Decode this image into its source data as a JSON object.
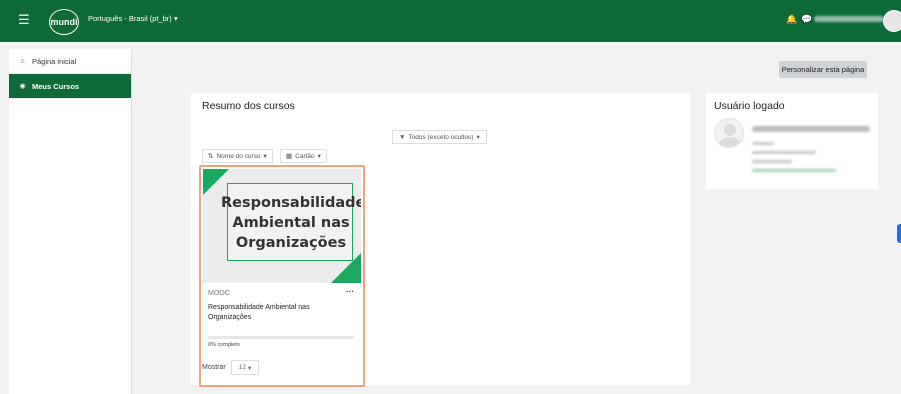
{
  "navbar": {
    "menu_icon": "hamburger-icon",
    "logo_text": "mundi",
    "language": "Português - Brasil (pt_br) ▾",
    "notification_icon": "bell-icon",
    "messages_icon": "chat-icon"
  },
  "sidebar": {
    "items": [
      {
        "label": "Página inicial",
        "icon": "home-icon"
      },
      {
        "label": "Meus Cursos",
        "icon": "courses-icon"
      }
    ]
  },
  "main": {
    "personalize_label": "Personalizar esta página"
  },
  "courses_block": {
    "title": "Resumo dos cursos",
    "filter_label": "Todos (exceto ocultos)",
    "sort_label": "Nome do curso",
    "view_label": "Cartão",
    "show_label": "Mostrar",
    "show_value": "12"
  },
  "course_card": {
    "image_text": "Responsabilidade Ambiental nas Organizações",
    "category": "MOOC",
    "menu": "···",
    "name": "Responsabilidade Ambiental nas Organizações",
    "progress_percent": 0,
    "progress_label": "0% completo"
  },
  "user_block": {
    "title": "Usuário logado"
  },
  "colors": {
    "brand_green": "#0f6a39",
    "accent_green": "#1aa960",
    "card_highlight": "#f0a27a",
    "background": "#f2f2f2"
  }
}
